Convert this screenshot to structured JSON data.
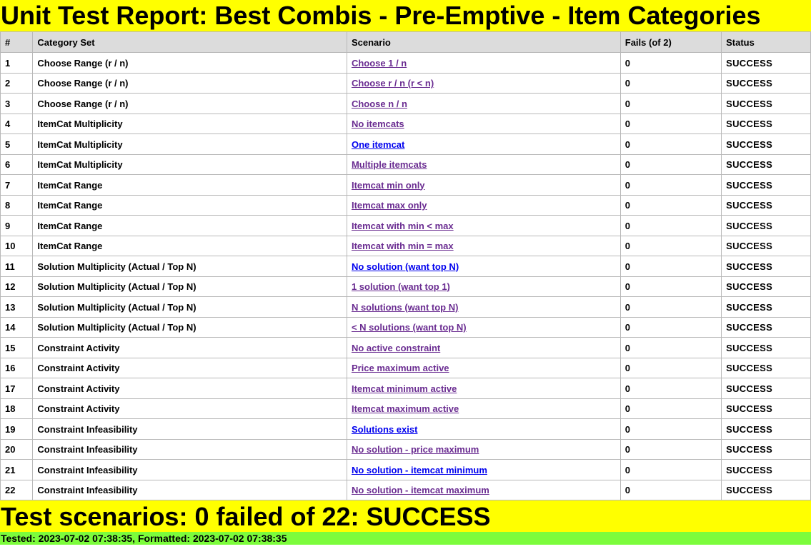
{
  "report": {
    "title": "Unit Test Report: Best Combis - Pre-Emptive - Item Categories",
    "summary": "Test scenarios: 0 failed of 22: SUCCESS",
    "tested": "Tested: 2023-07-02 07:38:35, Formatted: 2023-07-02 07:38:35",
    "colors": {
      "title_bg": "#ffff00",
      "tested_bg": "#7cfc3c",
      "header_bg": "#dcdcdc",
      "visited_link": "#6a2c91",
      "unvisited_link": "#0000ee"
    }
  },
  "table": {
    "headers": [
      "#",
      "Category Set",
      "Scenario",
      "Fails (of 2)",
      "Status"
    ],
    "rows": [
      {
        "num": "1",
        "category": "Choose Range (r / n)",
        "scenario": "Choose 1 / n",
        "visited": true,
        "fails": "0",
        "status": "SUCCESS"
      },
      {
        "num": "2",
        "category": "Choose Range (r / n)",
        "scenario": "Choose r / n (r < n)",
        "visited": true,
        "fails": "0",
        "status": "SUCCESS"
      },
      {
        "num": "3",
        "category": "Choose Range (r / n)",
        "scenario": "Choose n / n",
        "visited": true,
        "fails": "0",
        "status": "SUCCESS"
      },
      {
        "num": "4",
        "category": "ItemCat Multiplicity",
        "scenario": "No itemcats",
        "visited": true,
        "fails": "0",
        "status": "SUCCESS"
      },
      {
        "num": "5",
        "category": "ItemCat Multiplicity",
        "scenario": "One itemcat",
        "visited": false,
        "fails": "0",
        "status": "SUCCESS"
      },
      {
        "num": "6",
        "category": "ItemCat Multiplicity",
        "scenario": "Multiple itemcats",
        "visited": true,
        "fails": "0",
        "status": "SUCCESS"
      },
      {
        "num": "7",
        "category": "ItemCat Range",
        "scenario": "Itemcat min only",
        "visited": true,
        "fails": "0",
        "status": "SUCCESS"
      },
      {
        "num": "8",
        "category": "ItemCat Range",
        "scenario": "Itemcat max only",
        "visited": true,
        "fails": "0",
        "status": "SUCCESS"
      },
      {
        "num": "9",
        "category": "ItemCat Range",
        "scenario": "Itemcat with min < max",
        "visited": true,
        "fails": "0",
        "status": "SUCCESS"
      },
      {
        "num": "10",
        "category": "ItemCat Range",
        "scenario": "Itemcat with min = max",
        "visited": true,
        "fails": "0",
        "status": "SUCCESS"
      },
      {
        "num": "11",
        "category": "Solution Multiplicity (Actual / Top N)",
        "scenario": "No solution (want top N)",
        "visited": false,
        "fails": "0",
        "status": "SUCCESS"
      },
      {
        "num": "12",
        "category": "Solution Multiplicity (Actual / Top N)",
        "scenario": "1 solution (want top 1)",
        "visited": true,
        "fails": "0",
        "status": "SUCCESS"
      },
      {
        "num": "13",
        "category": "Solution Multiplicity (Actual / Top N)",
        "scenario": "N solutions (want top N)",
        "visited": true,
        "fails": "0",
        "status": "SUCCESS"
      },
      {
        "num": "14",
        "category": "Solution Multiplicity (Actual / Top N)",
        "scenario": "< N solutions (want top N)",
        "visited": true,
        "fails": "0",
        "status": "SUCCESS"
      },
      {
        "num": "15",
        "category": "Constraint Activity",
        "scenario": "No active constraint",
        "visited": true,
        "fails": "0",
        "status": "SUCCESS"
      },
      {
        "num": "16",
        "category": "Constraint Activity",
        "scenario": "Price maximum active",
        "visited": true,
        "fails": "0",
        "status": "SUCCESS"
      },
      {
        "num": "17",
        "category": "Constraint Activity",
        "scenario": "Itemcat minimum active",
        "visited": true,
        "fails": "0",
        "status": "SUCCESS"
      },
      {
        "num": "18",
        "category": "Constraint Activity",
        "scenario": "Itemcat maximum active",
        "visited": true,
        "fails": "0",
        "status": "SUCCESS"
      },
      {
        "num": "19",
        "category": "Constraint Infeasibility",
        "scenario": "Solutions exist",
        "visited": false,
        "fails": "0",
        "status": "SUCCESS"
      },
      {
        "num": "20",
        "category": "Constraint Infeasibility",
        "scenario": "No solution - price maximum",
        "visited": true,
        "fails": "0",
        "status": "SUCCESS"
      },
      {
        "num": "21",
        "category": "Constraint Infeasibility",
        "scenario": "No solution - itemcat minimum",
        "visited": false,
        "fails": "0",
        "status": "SUCCESS"
      },
      {
        "num": "22",
        "category": "Constraint Infeasibility",
        "scenario": "No solution - itemcat maximum",
        "visited": true,
        "fails": "0",
        "status": "SUCCESS"
      }
    ]
  }
}
